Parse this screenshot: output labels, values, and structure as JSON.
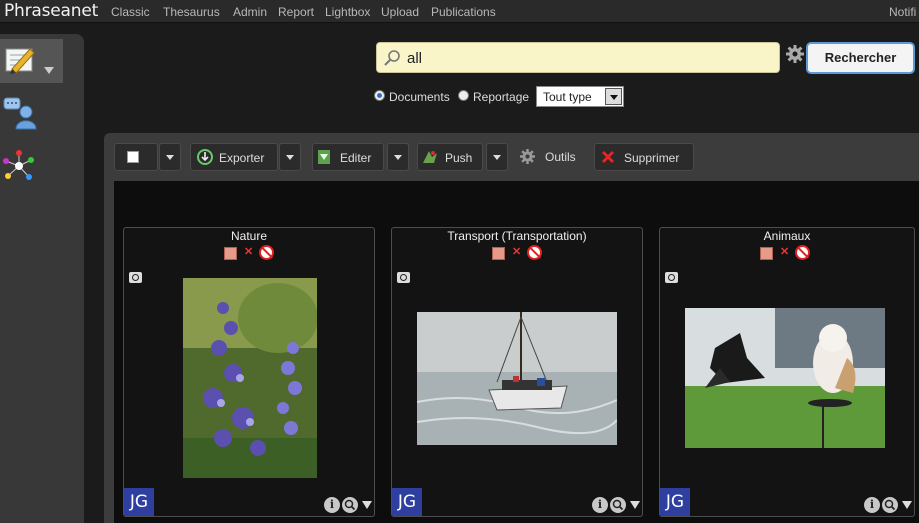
{
  "app": {
    "brand": "Phraseanet",
    "notifications_label": "Notifi"
  },
  "nav": {
    "items": [
      "Classic",
      "Thesaurus",
      "Admin",
      "Report",
      "Lightbox",
      "Upload",
      "Publications"
    ]
  },
  "search": {
    "value": "all",
    "button_label": "Rechercher"
  },
  "filters": {
    "options": [
      {
        "label": "Documents",
        "selected": true
      },
      {
        "label": "Reportage",
        "selected": false
      }
    ],
    "type_select": "Tout type"
  },
  "toolbar": {
    "export_label": "Exporter",
    "edit_label": "Editer",
    "push_label": "Push",
    "tools_label": "Outils",
    "delete_label": "Supprimer"
  },
  "results": [
    {
      "title": "Nature",
      "initials": "JG",
      "info_icon": "i"
    },
    {
      "title": "Transport (Transportation)",
      "initials": "JG",
      "info_icon": "i"
    },
    {
      "title": "Animaux",
      "initials": "JG",
      "info_icon": "i"
    }
  ],
  "colors": {
    "accent_blue": "#5b9ad6",
    "search_bg": "#f9f5c9",
    "initials_bg": "#2f3fa0"
  }
}
